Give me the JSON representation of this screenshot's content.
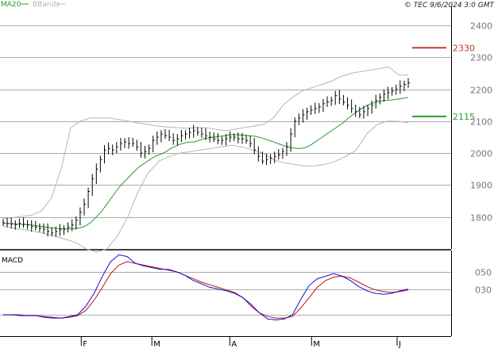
{
  "header": {
    "legend": [
      {
        "label": "MA20",
        "color": "#2a9a2a"
      },
      {
        "label": "BBands",
        "color": "#b5b5b5"
      }
    ],
    "copyright": "© TEC 9/6/2024 3:0 GMT"
  },
  "main_panel": {
    "y_ticks": [
      {
        "value": 1800,
        "label": "1800"
      },
      {
        "value": 1900,
        "label": "1900"
      },
      {
        "value": 2000,
        "label": "2000"
      },
      {
        "value": 2100,
        "label": "2100"
      },
      {
        "value": 2200,
        "label": "2200"
      },
      {
        "value": 2300,
        "label": "2300"
      },
      {
        "value": 2400,
        "label": "2400"
      }
    ],
    "levels": [
      {
        "name": "resistance",
        "value": 2330,
        "label": "2330",
        "color": "#c0392b"
      },
      {
        "name": "support",
        "value": 2115,
        "label": "2115",
        "color": "#27a02a"
      }
    ]
  },
  "macd_panel": {
    "title": "MACD",
    "y_ticks": [
      {
        "value": 50,
        "label": "050"
      },
      {
        "value": 30,
        "label": "030"
      }
    ]
  },
  "x_axis": {
    "months": [
      {
        "label": "F",
        "index": 21
      },
      {
        "label": "M",
        "index": 40
      },
      {
        "label": "A",
        "index": 61
      },
      {
        "label": "M",
        "index": 83
      },
      {
        "label": "J",
        "index": 106
      }
    ]
  },
  "colors": {
    "price_bars": "#000000",
    "ma20": "#2a9a2a",
    "bbands": "#b5b5b5",
    "macd_line": "#1010d0",
    "signal_line": "#c01010",
    "grid": "#aaaaaa"
  },
  "chart_data": [
    {
      "type": "line",
      "title": "",
      "description_series": [
        "price",
        "MA20",
        "BBands"
      ],
      "ylim": [
        1700,
        2460
      ],
      "x_points": 110,
      "series": [
        {
          "name": "price",
          "values": [
            1782,
            1780,
            1778,
            1776,
            1780,
            1778,
            1775,
            1770,
            1768,
            1765,
            1762,
            1755,
            1750,
            1755,
            1760,
            1762,
            1768,
            1775,
            1790,
            1815,
            1840,
            1880,
            1920,
            1950,
            1980,
            2010,
            2015,
            2010,
            2020,
            2030,
            2035,
            2030,
            2030,
            2020,
            2000,
            2005,
            2015,
            2040,
            2050,
            2060,
            2055,
            2050,
            2040,
            2045,
            2055,
            2060,
            2065,
            2070,
            2065,
            2060,
            2055,
            2050,
            2045,
            2040,
            2040,
            2045,
            2050,
            2050,
            2045,
            2045,
            2040,
            2030,
            2010,
            1990,
            1975,
            1980,
            1985,
            1990,
            1995,
            2005,
            2020,
            2060,
            2100,
            2110,
            2120,
            2130,
            2135,
            2140,
            2145,
            2155,
            2160,
            2165,
            2180,
            2170,
            2160,
            2150,
            2140,
            2130,
            2120,
            2130,
            2140,
            2150,
            2165,
            2175,
            2185,
            2190,
            2195,
            2200,
            2210,
            2215,
            2220
          ],
          "note": "daily close approx."
        },
        {
          "name": "MA20",
          "values": [
            1780,
            1780,
            1779,
            1778,
            1777,
            1776,
            1775,
            1773,
            1771,
            1769,
            1767,
            1765,
            1764,
            1763,
            1763,
            1763,
            1765,
            1768,
            1775,
            1785,
            1800,
            1815,
            1835,
            1855,
            1875,
            1895,
            1910,
            1925,
            1940,
            1955,
            1965,
            1975,
            1985,
            1992,
            1998,
            2005,
            2015,
            2022,
            2028,
            2032,
            2035,
            2035,
            2040,
            2045,
            2048,
            2050,
            2052,
            2054,
            2056,
            2058,
            2058,
            2057,
            2056,
            2055,
            2053,
            2050,
            2046,
            2040,
            2036,
            2030,
            2025,
            2020,
            2017,
            2015,
            2015,
            2018,
            2025,
            2035,
            2045,
            2055,
            2065,
            2075,
            2085,
            2095,
            2108,
            2120,
            2130,
            2140,
            2148,
            2155,
            2160,
            2163,
            2165,
            2166,
            2168,
            2170,
            2172,
            2175
          ],
          "note": "20-period moving average approx."
        },
        {
          "name": "BBands upper",
          "values": [
            1795,
            1798,
            1802,
            1806,
            1820,
            1860,
            1950,
            2080,
            2100,
            2110,
            2110,
            2110,
            2105,
            2100,
            2095,
            2090,
            2085,
            2082,
            2080,
            2078,
            2080,
            2080,
            2075,
            2070,
            2075,
            2080,
            2085,
            2090,
            2110,
            2150,
            2175,
            2195,
            2205,
            2215,
            2225,
            2240,
            2250,
            2255,
            2260,
            2265,
            2270,
            2245,
            2245
          ]
        },
        {
          "name": "BBands lower",
          "values": [
            1770,
            1765,
            1760,
            1755,
            1748,
            1740,
            1730,
            1720,
            1700,
            1690,
            1700,
            1740,
            1800,
            1880,
            1940,
            1975,
            1990,
            2000,
            2005,
            2010,
            2015,
            2020,
            2025,
            2020,
            2010,
            2000,
            1980,
            1970,
            1965,
            1960,
            1960,
            1965,
            1975,
            1990,
            2010,
            2060,
            2090,
            2100,
            2100,
            2095
          ]
        }
      ],
      "levels": [
        2330,
        2115
      ]
    },
    {
      "type": "line",
      "title": "MACD",
      "ylim": [
        -25,
        75
      ],
      "series": [
        {
          "name": "macd",
          "values": [
            0,
            0,
            -1,
            -1,
            -1,
            -3,
            -4,
            -4,
            -2,
            0,
            10,
            25,
            45,
            62,
            70,
            68,
            60,
            57,
            55,
            53,
            53,
            50,
            46,
            40,
            36,
            32,
            30,
            28,
            25,
            20,
            12,
            2,
            -5,
            -6,
            -5,
            0,
            18,
            34,
            42,
            45,
            48,
            45,
            40,
            33,
            28,
            25,
            24,
            25,
            28,
            30
          ]
        },
        {
          "name": "signal",
          "values": [
            0,
            0,
            0,
            -1,
            -1,
            -2,
            -3,
            -4,
            -3,
            -1,
            5,
            17,
            32,
            48,
            58,
            62,
            60,
            58,
            56,
            54,
            52,
            50,
            46,
            42,
            38,
            35,
            32,
            29,
            26,
            20,
            10,
            2,
            -2,
            -4,
            -4,
            -2,
            8,
            20,
            32,
            40,
            44,
            45,
            43,
            38,
            33,
            29,
            27,
            26,
            27,
            29
          ]
        }
      ]
    }
  ]
}
